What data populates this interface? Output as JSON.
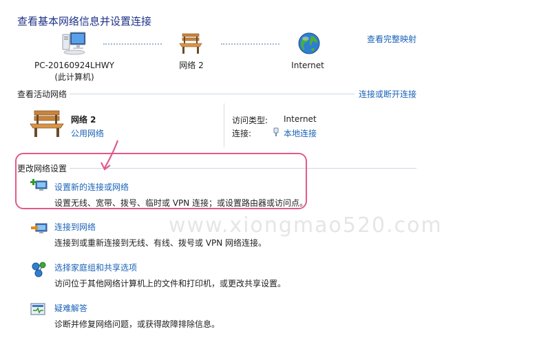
{
  "header": {
    "title": "查看基本网络信息并设置连接",
    "full_map_link": "查看完整映射"
  },
  "network_map": {
    "computer_name": "PC-20160924LHWY",
    "computer_sub": "(此计算机)",
    "network_name": "网络  2",
    "internet_label": "Internet"
  },
  "active_networks": {
    "section_title": "查看活动网络",
    "connect_link": "连接或断开连接",
    "network": {
      "name": "网络  2",
      "type_link": "公用网络"
    },
    "access_type_label": "访问类型:",
    "access_type_value": "Internet",
    "connection_label": "连接:",
    "connection_value": "本地连接"
  },
  "change_settings": {
    "section_title": "更改网络设置",
    "tasks": [
      {
        "title": "设置新的连接或网络",
        "desc": "设置无线、宽带、拨号、临时或 VPN 连接；或设置路由器或访问点。",
        "icon": "new-connection-icon"
      },
      {
        "title": "连接到网络",
        "desc": "连接到或重新连接到无线、有线、拨号或 VPN 网络连接。",
        "icon": "connect-network-icon"
      },
      {
        "title": "选择家庭组和共享选项",
        "desc": "访问位于其他网络计算机上的文件和打印机，或更改共享设置。",
        "icon": "homegroup-icon"
      },
      {
        "title": "疑难解答",
        "desc": "诊断并修复网络问题，或获得故障排除信息。",
        "icon": "troubleshoot-icon"
      }
    ]
  },
  "watermark": "www.xiongmao520.com",
  "colors": {
    "title": "#1e3287",
    "link": "#1a62b7",
    "highlight": "#e2588a"
  }
}
